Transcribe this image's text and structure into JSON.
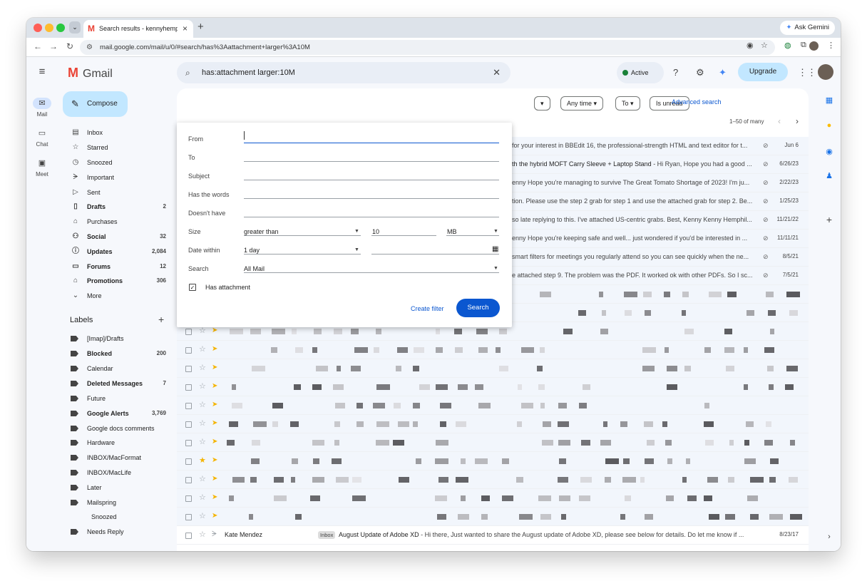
{
  "browser": {
    "tab_title": "Search results - kennyhemph",
    "ask_gemini": "Ask Gemini",
    "url": "mail.google.com/mail/u/0/#search/has%3Aattachment+larger%3A10M"
  },
  "rail": {
    "mail": "Mail",
    "chat": "Chat",
    "meet": "Meet"
  },
  "app": {
    "name": "Gmail",
    "compose": "Compose"
  },
  "nav": [
    {
      "label": "Inbox",
      "icon": "inbox-icon",
      "count": ""
    },
    {
      "label": "Starred",
      "icon": "star-icon",
      "count": ""
    },
    {
      "label": "Snoozed",
      "icon": "clock-icon",
      "count": ""
    },
    {
      "label": "Important",
      "icon": "important-icon",
      "count": ""
    },
    {
      "label": "Sent",
      "icon": "send-icon",
      "count": ""
    },
    {
      "label": "Drafts",
      "icon": "draft-icon",
      "count": "2"
    },
    {
      "label": "Purchases",
      "icon": "tag-icon",
      "count": ""
    },
    {
      "label": "Social",
      "icon": "people-icon",
      "count": "32"
    },
    {
      "label": "Updates",
      "icon": "info-icon",
      "count": "2,084"
    },
    {
      "label": "Forums",
      "icon": "forum-icon",
      "count": "12"
    },
    {
      "label": "Promotions",
      "icon": "tag-icon",
      "count": "306"
    },
    {
      "label": "More",
      "icon": "chevron-down-icon",
      "count": ""
    }
  ],
  "labels": {
    "header": "Labels",
    "items": [
      {
        "label": "[Imap]/Drafts",
        "count": ""
      },
      {
        "label": "Blocked",
        "count": "200"
      },
      {
        "label": "Calendar",
        "count": ""
      },
      {
        "label": "Deleted Messages",
        "count": "7"
      },
      {
        "label": "Future",
        "count": ""
      },
      {
        "label": "Google Alerts",
        "count": "3,769"
      },
      {
        "label": "Google docs comments",
        "count": ""
      },
      {
        "label": "Hardware",
        "count": ""
      },
      {
        "label": "INBOX/MacFormat",
        "count": ""
      },
      {
        "label": "INBOX/MacLife",
        "count": ""
      },
      {
        "label": "Later",
        "count": ""
      },
      {
        "label": "Mailspring",
        "count": ""
      },
      {
        "label": "Snoozed",
        "count": ""
      },
      {
        "label": "Needs Reply",
        "count": ""
      }
    ]
  },
  "search": {
    "query": "has:attachment larger:10M"
  },
  "header": {
    "status": "Active",
    "upgrade": "Upgrade"
  },
  "filters": {
    "any_time": "Any time",
    "to": "To",
    "is_unread": "Is unread",
    "advanced": "Advanced search"
  },
  "pager": {
    "range": "1–50 of many"
  },
  "emails": [
    {
      "subject": "for your interest in BBEdit 16, the professional-strength HTML and text editor for t...",
      "date": "Jun 6"
    },
    {
      "subject": "th the hybrid MOFT Carry Sleeve + Laptop Stand",
      "snippet": " - Hi Ryan, Hope you had a good ...",
      "date": "6/26/23"
    },
    {
      "subject": "enny Hope you're managing to survive The Great Tomato Shortage of 2023! I'm ju...",
      "date": "2/22/23"
    },
    {
      "subject": "tion. Please use the step 2 grab for step 1 and use the attached grab for step 2. Be...",
      "date": "1/25/23"
    },
    {
      "subject": "so late replying to this. I've attached US-centric grabs. Best, Kenny Kenny Hemphil...",
      "date": "11/21/22"
    },
    {
      "subject": "enny Hope you're keeping safe and well... just wondered if you'd be interested in ...",
      "date": "11/11/21"
    },
    {
      "subject": "smart filters for meetings you regularly attend so you can see quickly when the ne...",
      "date": "8/5/21"
    },
    {
      "subject": "e attached step 9. The problem was the PDF. It worked ok with other PDFs. So I sc...",
      "date": "7/5/21"
    }
  ],
  "last_email": {
    "sender": "Kate Mendez",
    "badge": "Inbox",
    "subject": "August Update of Adobe XD",
    "snippet": " - Hi there, Just wanted to share the August update of Adobe XD, please see below for details. Do let me know if ...",
    "date": "8/23/17"
  },
  "advanced_search": {
    "from": "From",
    "to": "To",
    "subject": "Subject",
    "has_words": "Has the words",
    "doesnt_have": "Doesn't have",
    "size": "Size",
    "size_op": "greater than",
    "size_value": "10",
    "size_unit": "MB",
    "date_within": "Date within",
    "date_value": "1 day",
    "search_in": "Search",
    "search_value": "All Mail",
    "has_attachment": "Has attachment",
    "has_attachment_checked": true,
    "create_filter": "Create filter",
    "search_button": "Search"
  },
  "colors": {
    "accent": "#0b57d0",
    "compose_bg": "#c2e7ff",
    "background": "#f6f8fc"
  }
}
